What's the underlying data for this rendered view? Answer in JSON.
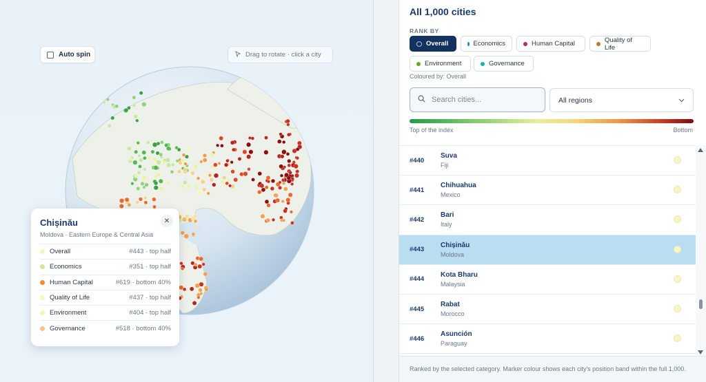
{
  "controls": {
    "auto_spin_label": "Auto spin",
    "drag_hint": "Drag to rotate · click a city"
  },
  "tooltip": {
    "city": "Chișinău",
    "subtitle": "Moldova · Eastern Europe & Central Asia",
    "close_icon": "close-icon",
    "rows": [
      {
        "label": "Overall",
        "value": "#443 · top half",
        "color": "#f8f6c0"
      },
      {
        "label": "Economics",
        "value": "#351 · top half",
        "color": "#c8e8a0"
      },
      {
        "label": "Human Capital",
        "value": "#619 · bottom 40%",
        "color": "#ef8a3c"
      },
      {
        "label": "Quality of Life",
        "value": "#437 · top half",
        "color": "#f8f6c0"
      },
      {
        "label": "Environment",
        "value": "#404 · top half",
        "color": "#f6f3b8"
      },
      {
        "label": "Governance",
        "value": "#518 · bottom 40%",
        "color": "#f6c77a"
      }
    ]
  },
  "panel": {
    "title": "All 1,000 cities",
    "rank_by_label": "RANK BY",
    "categories": [
      {
        "label": "Overall",
        "color": "#14325e",
        "active": true
      },
      {
        "label": "Economics",
        "color": "#1c8ad8"
      },
      {
        "label": "Human Capital",
        "color": "#c0237f"
      },
      {
        "label": "Quality of Life",
        "color": "#c07a2c"
      },
      {
        "label": "Environment",
        "color": "#6aa82b"
      },
      {
        "label": "Governance",
        "color": "#1bb0b8"
      }
    ],
    "coloured_by": "Coloured by: Overall",
    "search_placeholder": "Search cities...",
    "region_select": "All regions",
    "legend_top": "Top of the index",
    "legend_bottom": "Bottom",
    "cities": [
      {
        "rank": "#440",
        "name": "Suva",
        "country": "Fiji",
        "selected": false
      },
      {
        "rank": "#441",
        "name": "Chihuahua",
        "country": "Mexico",
        "selected": false
      },
      {
        "rank": "#442",
        "name": "Bari",
        "country": "Italy",
        "selected": false
      },
      {
        "rank": "#443",
        "name": "Chișinău",
        "country": "Moldova",
        "selected": true
      },
      {
        "rank": "#444",
        "name": "Kota Bharu",
        "country": "Malaysia",
        "selected": false
      },
      {
        "rank": "#445",
        "name": "Rabat",
        "country": "Morocco",
        "selected": false
      },
      {
        "rank": "#446",
        "name": "Asunción",
        "country": "Paraguay",
        "selected": false
      }
    ],
    "footer": "Ranked by the selected category. Marker colour shows each city's position band within the full 1,000."
  }
}
